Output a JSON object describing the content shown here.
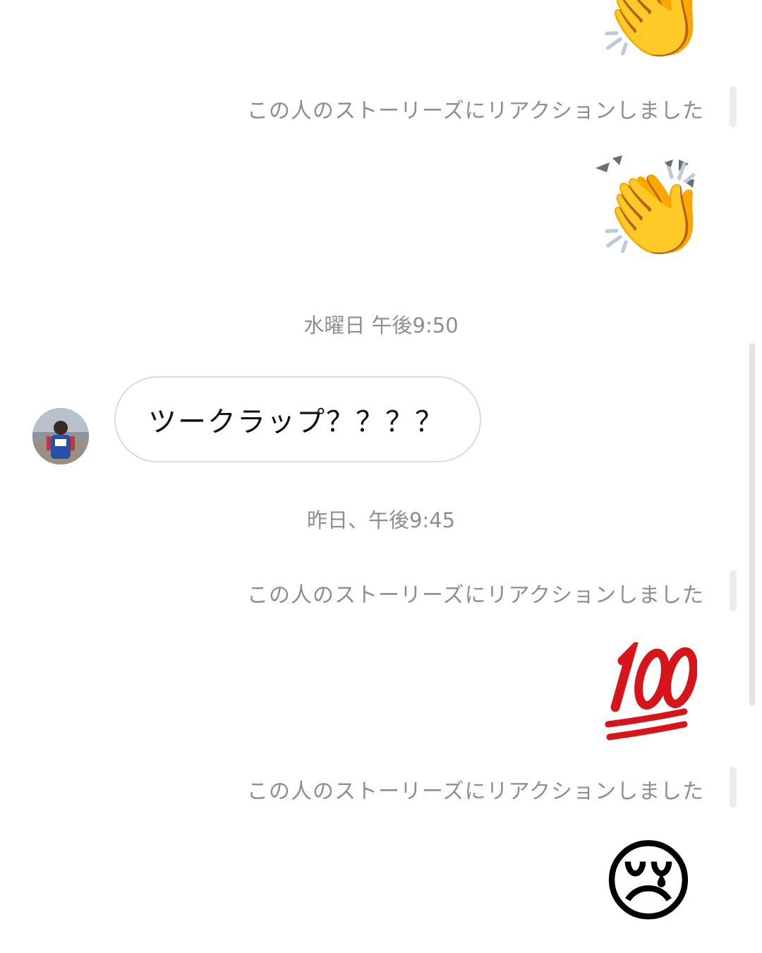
{
  "thread": {
    "messages": [
      {
        "type": "emoji",
        "emoji": "👏",
        "icon": "clapping-hands-icon"
      },
      {
        "type": "story_note",
        "text": "この人のストーリーズにリアクションしました"
      },
      {
        "type": "emoji",
        "emoji": "👏",
        "icon": "clapping-hands-icon"
      },
      {
        "type": "timestamp",
        "text": "水曜日 午後9:50"
      },
      {
        "type": "received",
        "text": "ツークラップ？？？？"
      },
      {
        "type": "timestamp",
        "text": "昨日、午後9:45"
      },
      {
        "type": "story_note",
        "text": "この人のストーリーズにリアクションしました"
      },
      {
        "type": "emoji",
        "emoji": "💯",
        "icon": "hundred-points-icon"
      },
      {
        "type": "story_note",
        "text": "この人のストーリーズにリアクションしました"
      },
      {
        "type": "emoji",
        "emoji": "😢",
        "icon": "crying-face-icon"
      }
    ]
  },
  "colors": {
    "meta_text": "#8e8e8e",
    "bubble_border": "#dbdbdb",
    "hundred_red": "#d7141a"
  }
}
